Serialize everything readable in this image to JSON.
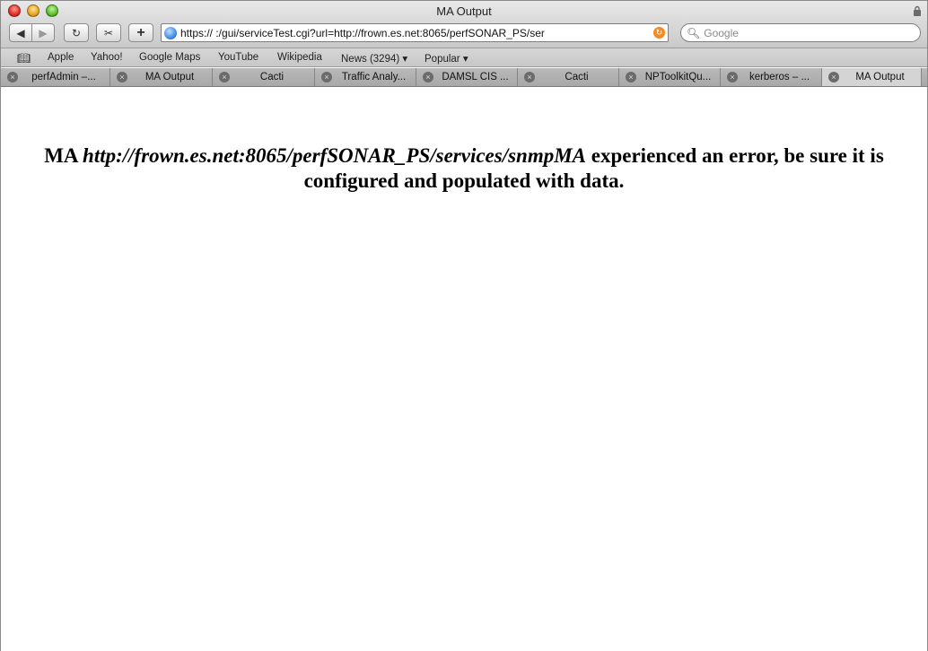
{
  "window": {
    "title": "MA Output"
  },
  "toolbar": {
    "back": "◀",
    "forward": "▶",
    "reload": "↻",
    "snap": "✂",
    "add": "+",
    "url": "https://                  :/gui/serviceTest.cgi?url=http://frown.es.net:8065/perfSONAR_PS/ser",
    "search_placeholder": "Google"
  },
  "bookmarks": [
    "Apple",
    "Yahoo!",
    "Google Maps",
    "YouTube",
    "Wikipedia",
    "News (3294)",
    "Popular"
  ],
  "tabs": [
    {
      "label": "perfAdmin –..."
    },
    {
      "label": "MA Output"
    },
    {
      "label": "Cacti"
    },
    {
      "label": "Traffic Analy..."
    },
    {
      "label": "DAMSL CIS ..."
    },
    {
      "label": "Cacti"
    },
    {
      "label": "NPToolkitQu..."
    },
    {
      "label": "kerberos – ..."
    },
    {
      "label": "MA Output"
    }
  ],
  "content": {
    "prefix": "MA ",
    "service_url": "http://frown.es.net:8065/perfSONAR_PS/services/snmpMA",
    "suffix": " experienced an error, be sure it is configured and populated with data."
  }
}
